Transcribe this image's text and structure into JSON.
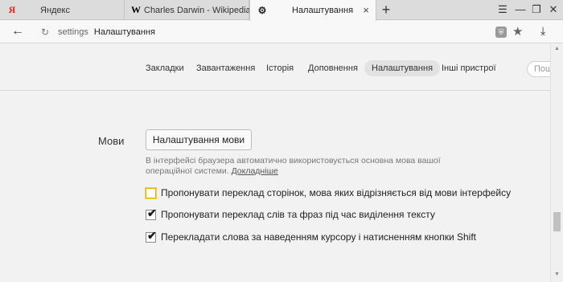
{
  "tabs": [
    {
      "title": "Яндекс",
      "favicon": "yandex-logo",
      "favicon_text": "Я",
      "close": "×"
    },
    {
      "title": "Charles Darwin - Wikipedia",
      "favicon": "wikipedia-logo",
      "favicon_text": "W",
      "close": "×"
    },
    {
      "title": "Налаштування",
      "favicon": "gear-icon",
      "close": "×",
      "active": true
    }
  ],
  "address_bar": {
    "host": "settings",
    "page": "Налаштування"
  },
  "settings_nav": {
    "tabs": [
      "Закладки",
      "Завантаження",
      "Історія",
      "Доповнення",
      "Налаштування",
      "Інші пристрої"
    ],
    "active": "Налаштування",
    "search_placeholder": "Пош"
  },
  "languages_section": {
    "label": "Мови",
    "button_label": "Налаштування мови",
    "description": "В інтерфейсі браузера автоматично використовується основна мова вашої операційної системи.",
    "details_link": "Докладніше",
    "options": [
      {
        "label": "Пропонувати переклад сторінок, мова яких відрізняється від мови інтерфейсу",
        "checked": false,
        "focused": true
      },
      {
        "label": "Пропонувати переклад слів та фраз під час виділення тексту",
        "checked": true
      },
      {
        "label": "Перекладати слова за наведенням курсору і натисненням кнопки Shift",
        "checked": true
      }
    ]
  },
  "colors": {
    "yandex_red": "#e52620",
    "focus_yellow": "#f6d24a"
  }
}
